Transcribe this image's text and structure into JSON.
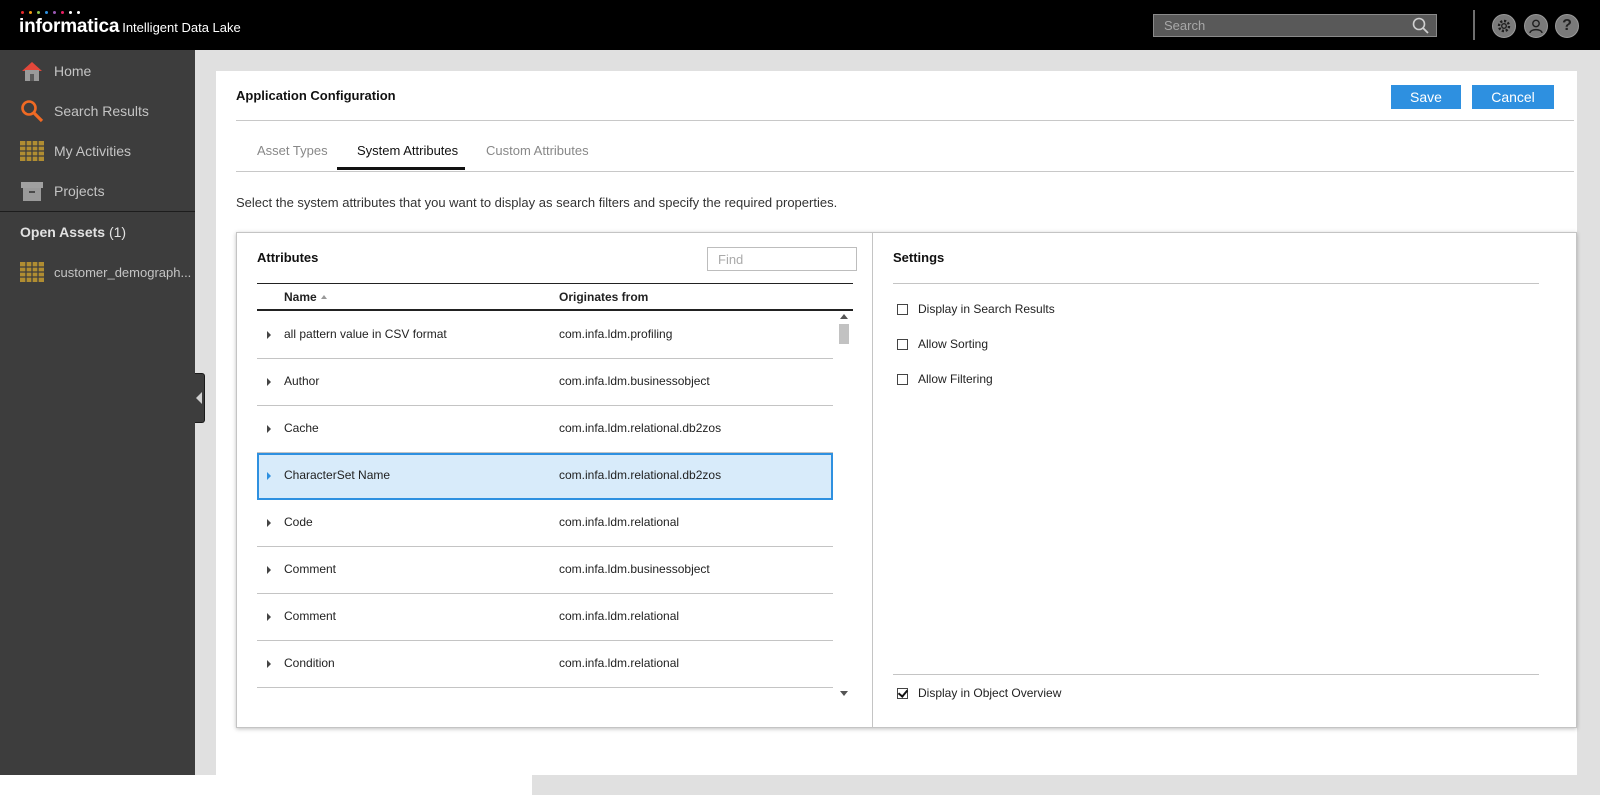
{
  "app": {
    "brand": "informatica",
    "product": "Intelligent Data Lake",
    "logo_dot_colors": [
      "#e8282b",
      "#f39c12",
      "#8bc34a",
      "#2e90e0",
      "#9b59b6",
      "#e91e63",
      "#ffffff",
      "#ffffff"
    ]
  },
  "topbar": {
    "search_placeholder": "Search",
    "help_glyph": "?"
  },
  "sidebar": {
    "items": [
      {
        "label": "Home",
        "icon": "home-icon"
      },
      {
        "label": "Search Results",
        "icon": "search-icon"
      },
      {
        "label": "My Activities",
        "icon": "grid-icon"
      },
      {
        "label": "Projects",
        "icon": "projects-icon"
      }
    ],
    "open_assets": {
      "label": "Open Assets",
      "count": "(1)"
    },
    "assets": [
      {
        "label": "customer_demograph...",
        "icon": "table-icon"
      }
    ]
  },
  "page": {
    "title": "Application Configuration",
    "save_label": "Save",
    "cancel_label": "Cancel",
    "tabs": [
      {
        "label": "Asset Types",
        "active": false
      },
      {
        "label": "System Attributes",
        "active": true
      },
      {
        "label": "Custom Attributes",
        "active": false
      }
    ],
    "instructions": "Select the system attributes that you want to display as search filters and specify the required properties."
  },
  "attributes": {
    "title": "Attributes",
    "find_placeholder": "Find",
    "columns": {
      "name": "Name",
      "origin": "Originates from"
    },
    "rows": [
      {
        "name": "all pattern value in CSV format",
        "origin": "com.infa.ldm.profiling",
        "selected": false
      },
      {
        "name": "Author",
        "origin": "com.infa.ldm.businessobject",
        "selected": false
      },
      {
        "name": "Cache",
        "origin": "com.infa.ldm.relational.db2zos",
        "selected": false
      },
      {
        "name": "CharacterSet Name",
        "origin": "com.infa.ldm.relational.db2zos",
        "selected": true
      },
      {
        "name": "Code",
        "origin": "com.infa.ldm.relational",
        "selected": false
      },
      {
        "name": "Comment",
        "origin": "com.infa.ldm.businessobject",
        "selected": false
      },
      {
        "name": "Comment",
        "origin": "com.infa.ldm.relational",
        "selected": false
      },
      {
        "name": "Condition",
        "origin": "com.infa.ldm.relational",
        "selected": false
      }
    ]
  },
  "settings": {
    "title": "Settings",
    "options": [
      {
        "label": "Display in Search Results",
        "checked": false
      },
      {
        "label": "Allow Sorting",
        "checked": false
      },
      {
        "label": "Allow Filtering",
        "checked": false
      }
    ],
    "bottom_option": {
      "label": "Display in Object Overview",
      "checked": true
    }
  },
  "colors": {
    "accent": "#2e90e0",
    "topbar": "#000000",
    "sidebar": "#3d3d3d",
    "selected_row": "#d8ebfa"
  }
}
